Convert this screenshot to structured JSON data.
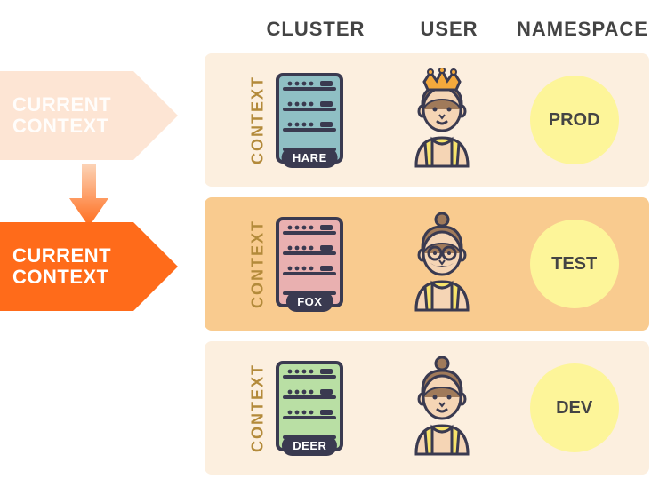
{
  "headers": {
    "cluster": "CLUSTER",
    "user": "USER",
    "namespace": "NAMESPACE"
  },
  "pointer": {
    "faded_label": "CURRENT\nCONTEXT",
    "active_label": "CURRENT\nCONTEXT"
  },
  "rows": [
    {
      "context_label": "CONTEXT",
      "cluster_name": "HARE",
      "namespace": "PROD",
      "server_fill": "#8fbfc4",
      "user_variant": "crown",
      "highlight": false
    },
    {
      "context_label": "CONTEXT",
      "cluster_name": "FOX",
      "namespace": "TEST",
      "server_fill": "#e9b0b0",
      "user_variant": "glasses",
      "highlight": true
    },
    {
      "context_label": "CONTEXT",
      "cluster_name": "DEER",
      "namespace": "DEV",
      "server_fill": "#b9dfa4",
      "user_variant": "bun",
      "highlight": false
    }
  ]
}
